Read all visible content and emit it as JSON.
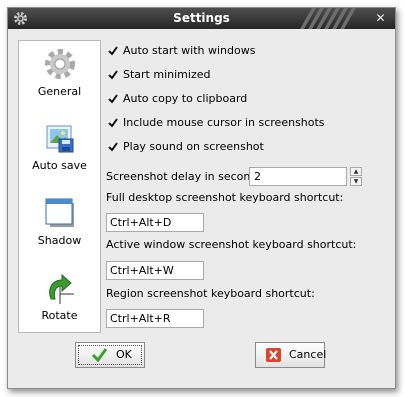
{
  "window": {
    "title": "Settings"
  },
  "sidebar": {
    "items": [
      {
        "label": "General",
        "icon": "gear-icon",
        "selected": true
      },
      {
        "label": "Auto save",
        "icon": "image-save-icon",
        "selected": false
      },
      {
        "label": "Shadow",
        "icon": "window-shadow-icon",
        "selected": false
      },
      {
        "label": "Rotate",
        "icon": "rotate-arrow-icon",
        "selected": false
      }
    ]
  },
  "general": {
    "checkboxes": [
      {
        "label": "Auto start with windows",
        "checked": true
      },
      {
        "label": "Start minimized",
        "checked": true
      },
      {
        "label": "Auto copy to clipboard",
        "checked": true
      },
      {
        "label": "Include mouse cursor in screenshots",
        "checked": true
      },
      {
        "label": "Play sound on screenshot",
        "checked": true
      }
    ],
    "delay": {
      "label": "Screenshot delay in seconds:",
      "value": "2"
    },
    "shortcuts": [
      {
        "label": "Full desktop screenshot keyboard shortcut:",
        "value": "Ctrl+Alt+D"
      },
      {
        "label": "Active window screenshot keyboard shortcut:",
        "value": "Ctrl+Alt+W"
      },
      {
        "label": "Region screenshot keyboard shortcut:",
        "value": "Ctrl+Alt+R"
      }
    ]
  },
  "buttons": {
    "ok": "OK",
    "cancel": "Cancel"
  },
  "colors": {
    "titlebar": "#333333",
    "ok_check": "#3aa12b",
    "cancel_x": "#d8452b"
  }
}
